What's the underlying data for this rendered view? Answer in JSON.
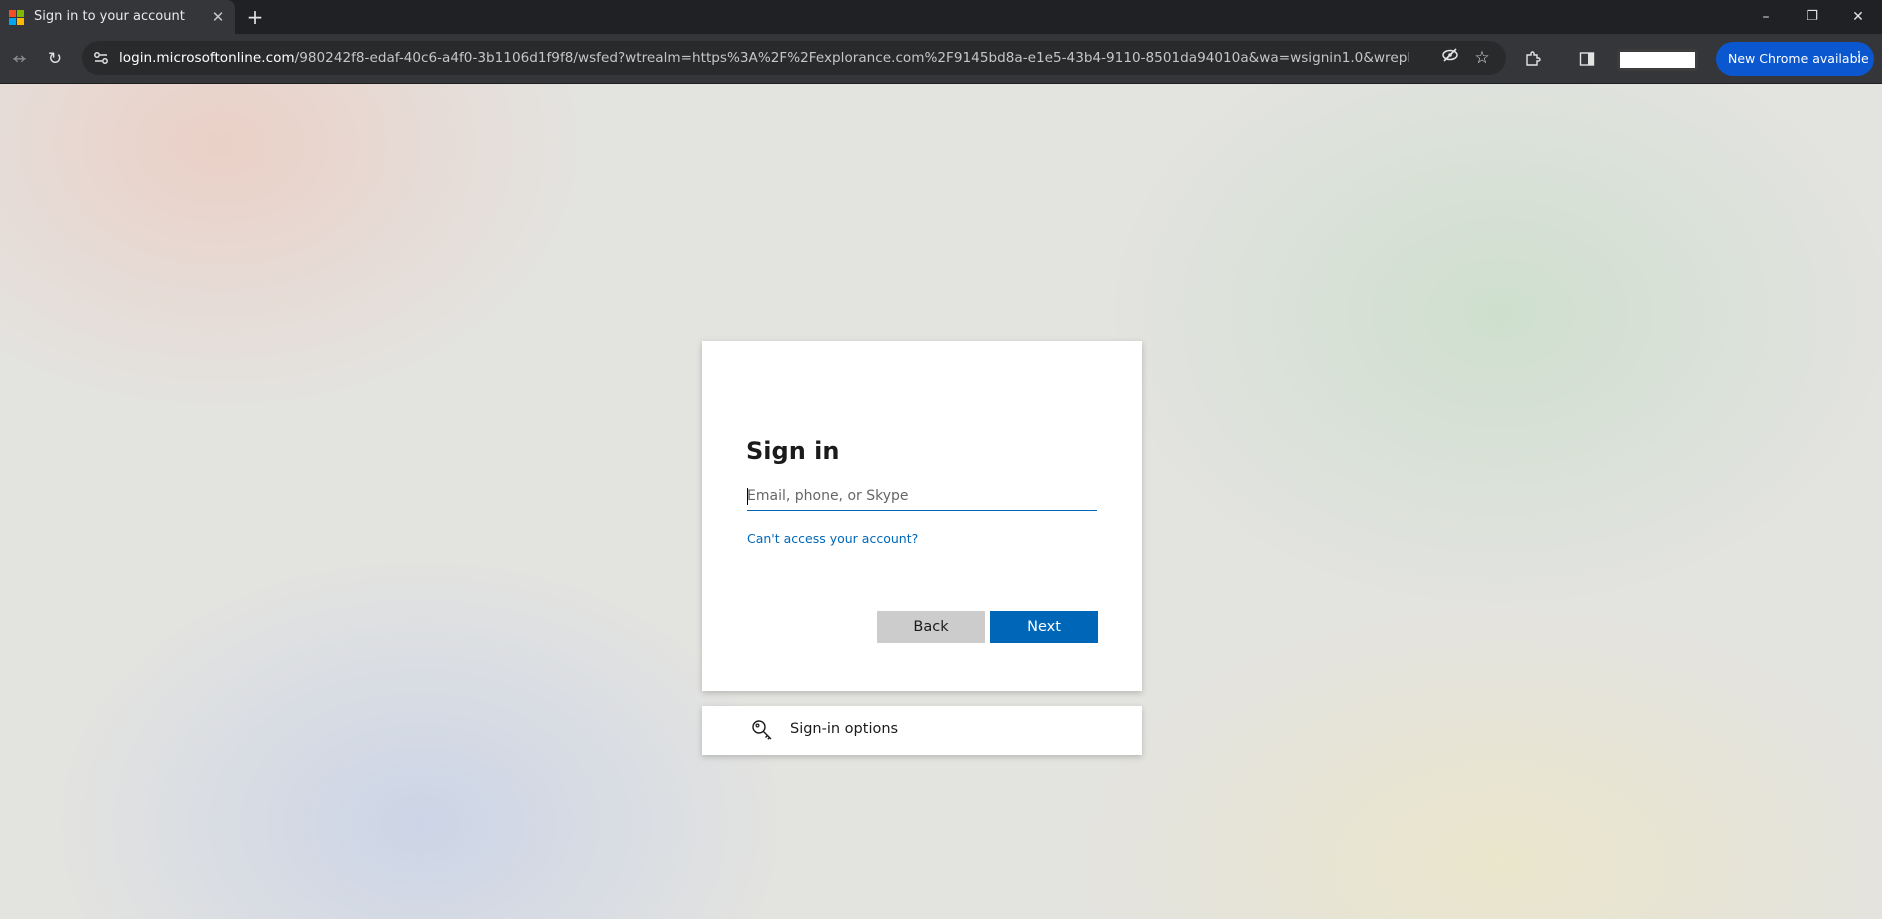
{
  "browser": {
    "tab": {
      "title": "Sign in to your account",
      "favicon": "microsoft-logo-icon",
      "close_icon": "close-icon"
    },
    "new_tab_icon": "plus-icon",
    "window_controls": {
      "minimize": "–",
      "restore": "❐",
      "close": "✕"
    },
    "nav": {
      "back": "←",
      "forward": "→",
      "reload": "↻"
    },
    "url_host": "login.microsoftonline.com",
    "url_path": "/980242f8-edaf-40c6-a4f0-3b1106d1f9f8/wsfed?wtrealm=https%3A%2F%2Fexplorance.com%2F9145bd8a-e1e5-43b4-9110-8501da94010a&wa=wsignin1.0&wreply=https%3A%2F%2Fb...",
    "update_chip_label": "New Chrome available",
    "accent": "#0b57d0"
  },
  "signin": {
    "title": "Sign in",
    "email_placeholder": "Email, phone, or Skype",
    "email_value": "",
    "cant_access_link": "Can't access your account?",
    "back_label": "Back",
    "next_label": "Next",
    "primary_color": "#0067b8"
  },
  "options": {
    "label": "Sign-in options",
    "icon": "key-icon"
  }
}
